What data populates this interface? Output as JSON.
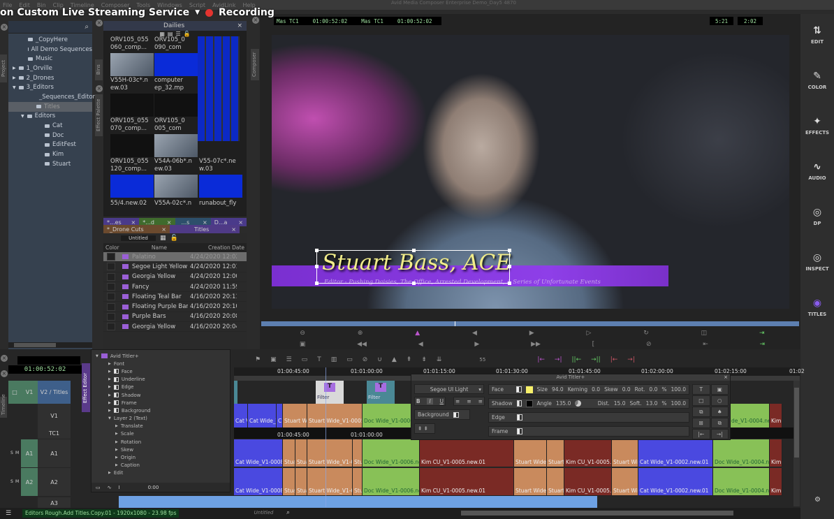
{
  "window": {
    "title": "Avid Media Composer Enterprise Demo_Day5 4870",
    "menu": [
      "File",
      "Edit",
      "Bin",
      "Clip",
      "Timeline",
      "Composer",
      "Tools",
      "Windows",
      "Script",
      "AvidLink",
      "Help"
    ]
  },
  "overlay": {
    "stream_title": "on Custom Live Streaming Service",
    "recording": "Recording",
    "rec_color": "#e3342f"
  },
  "project": {
    "tab": "Project",
    "items": [
      {
        "label": "_CopyHere",
        "depth": 1
      },
      {
        "label": "All Demo Sequences",
        "depth": 1
      },
      {
        "label": "Music",
        "depth": 1
      },
      {
        "label": "1_Orville",
        "depth": 0
      },
      {
        "label": "2_Drones",
        "depth": 0
      },
      {
        "label": "3_Editors",
        "depth": 0
      },
      {
        "label": "_Sequences_Editors",
        "depth": 2
      },
      {
        "label": "Titles",
        "depth": 2,
        "selected": true
      },
      {
        "label": "Editors",
        "depth": 1
      },
      {
        "label": "Cat",
        "depth": 3
      },
      {
        "label": "Doc",
        "depth": 3
      },
      {
        "label": "EditFest",
        "depth": 3
      },
      {
        "label": "Kim",
        "depth": 3
      },
      {
        "label": "Stuart",
        "depth": 3
      }
    ]
  },
  "side_tabs": {
    "bins": "Bins",
    "effect_palette": "Effect Palette",
    "composer": "Composer",
    "timeline": "Timeline",
    "effect_editor": "Effect Editor"
  },
  "dailies_bin": {
    "tab": "Dailies",
    "thumbs": [
      {
        "label": "ORV105_055 060_comp...",
        "kind": "video"
      },
      {
        "label": "ORV105_0 090_com",
        "kind": "audio"
      },
      {
        "label": "V55H-03c*.n ew.03",
        "kind": "dark"
      },
      {
        "label": "computer ep_32.mp",
        "kind": "dark"
      },
      {
        "label": "ORV105_055 070_comp...",
        "kind": "dark"
      },
      {
        "label": "ORV105_0 005_com",
        "kind": "video"
      },
      {
        "label": "ORV105_055 120_comp...",
        "kind": "audio"
      },
      {
        "label": "V54A-06b*.n ew.03",
        "kind": "video"
      },
      {
        "label": "V55-07c*.ne w.03",
        "kind": "audio"
      },
      {
        "label": "55/4.new.02",
        "kind": ""
      },
      {
        "label": "V55A-02c*.n",
        "kind": ""
      },
      {
        "label": "runabout_fly",
        "kind": ""
      }
    ]
  },
  "bin_tabs": [
    {
      "label": "*...es",
      "color": "#4a3a8a"
    },
    {
      "label": "*...d",
      "color": "#3f6b2d"
    },
    {
      "label": "_...s",
      "color": "#2d4f6b"
    },
    {
      "label": "D...a",
      "color": "#4a3a8a"
    }
  ],
  "titles_bin": {
    "tabs": [
      "*_Drone Cuts",
      "Titles"
    ],
    "view": "Untitled",
    "columns": [
      "Color",
      "Name",
      "Creation Date"
    ],
    "rows": [
      {
        "name": "Palatino",
        "date": "4/24/2020 12:02:",
        "selected": true
      },
      {
        "name": "Segoe Light Yellow",
        "date": "4/24/2020 12:01:"
      },
      {
        "name": "Georgia Yellow",
        "date": "4/24/2020 12:00:"
      },
      {
        "name": "Fancy",
        "date": "4/24/2020 11:59:"
      },
      {
        "name": "Floating Teal Bar",
        "date": "4/16/2020 20:11:"
      },
      {
        "name": "Floating Purple Bar",
        "date": "4/16/2020 20:10:"
      },
      {
        "name": "Purple Bars",
        "date": "4/16/2020 20:08:"
      },
      {
        "name": "Georgia Yellow",
        "date": "4/16/2020 20:04:"
      }
    ]
  },
  "composer": {
    "tc1_label": "Mas TC1",
    "tc1": "01:00:52:02",
    "tc2_label": "Mas TC1",
    "tc2": "01:00:52:02",
    "dur1": "5:21",
    "dur2": "2:02",
    "title_main": "Stuart Bass, ACE",
    "title_sub": "Editor - Pushing Daisies, The Office, Arrested Development, A Series of Unfortunate Events",
    "playhead_fraction": 0.36
  },
  "rightbar": [
    "EDIT",
    "COLOR",
    "EFFECTS",
    "AUDIO",
    "DP",
    "INSPECT",
    "TITLES"
  ],
  "timeline": {
    "timecode": "01:00:52:02",
    "ruler": [
      "01:00:45:00",
      "01:01:00:00",
      "01:01:15:00",
      "01:01:30:00",
      "01:01:45:00",
      "01:02:00:00",
      "01:02:15:00",
      "01:02"
    ],
    "ruler2": [
      "01:00:45:00",
      "01:01:00:00"
    ],
    "tracks": {
      "v1_src": "V1",
      "v2": "V2 / Titles",
      "v1": "V1",
      "tc1": "TC1",
      "a1_src": "A1",
      "a1": "A1",
      "a2_src": "A2",
      "a2": "A2",
      "a3": "A3",
      "s": "S",
      "m": "M"
    },
    "filters": [
      "Filter",
      "Filter"
    ],
    "fps_label": "55",
    "v1_clips": [
      "Cat V",
      "Cat Wide_V",
      "C",
      "Stuart Wi",
      "Stuart Wide_V1-0005.ne",
      "Doc Wide_V1-0006.n",
      "de_V1-0004.nev",
      "Kim"
    ],
    "a_clips": [
      "Cat Wide_V1-0008",
      "Stua",
      "Stua",
      "Stuart Wide_V1-000",
      "Stu",
      "Doc Wide_V1-0006.new.0",
      "Kim CU_V1-0005.new.01",
      "Stuart Wide_\\",
      "Stuart",
      "Kim CU_V1-0005.new",
      "Stuart Wid",
      "Cat Wide_V1-0002.new.01",
      "Doc Wide_V1-0004.nev",
      "Kim"
    ],
    "status": "Editors Rough.Add Titles.Copy.01 - 1920x1080 - 23.98 fps",
    "view": "Untitled"
  },
  "effect_editor": {
    "root": "Avid Titler+",
    "items": [
      "Font",
      "Face",
      "Underline",
      "Edge",
      "Shadow",
      "Frame",
      "Background",
      "Layer 2 (Text)",
      "Translate",
      "Scale",
      "Rotation",
      "Skew",
      "Origin",
      "Caption",
      "Edit"
    ],
    "time": "0:00"
  },
  "titler": {
    "title": "Avid Titler+",
    "font": "Segoe UI Light",
    "bold": "B",
    "italic": "I",
    "underline": "U",
    "background": "Background",
    "face": "Face",
    "face_color": "#f7f06a",
    "size_label": "Size",
    "size": "94.0",
    "kerning_label": "Kerning",
    "kerning": "0.0",
    "skew_label": "Skew",
    "skew": "0.0",
    "rot_label": "Rot.",
    "rot": "0.0",
    "pct_label": "%",
    "face_pct": "100.0",
    "shadow": "Shadow",
    "shadow_color": "#000000",
    "angle_label": "Angle",
    "angle": "135.0",
    "dist_label": "Dist.",
    "dist": "15.0",
    "soft_label": "Soft.",
    "soft": "13.0",
    "shadow_pct": "100.0",
    "edge": "Edge",
    "frame": "Frame"
  }
}
